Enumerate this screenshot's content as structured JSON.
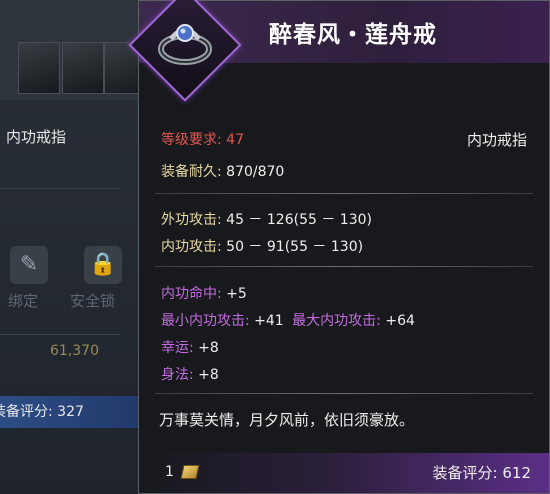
{
  "background_panel": {
    "item_type": "内功戒指",
    "bound_label": "绑定",
    "lock_label": "安全锁",
    "gold": "61,370",
    "score_label": "装备评分:",
    "score_value": "327"
  },
  "tooltip": {
    "item_name": "醉春风・莲舟戒",
    "level_req_label": "等级要求:",
    "level_req_value": "47",
    "item_type": "内功戒指",
    "durability_label": "装备耐久:",
    "durability_value": "870/870",
    "outer_attack_label": "外功攻击:",
    "outer_attack_value": "45 － 126(55 － 130)",
    "inner_attack_label": "内功攻击:",
    "inner_attack_value": "50 － 91(55 － 130)",
    "bonus_stats": [
      {
        "label": "内功命中:",
        "value": "+5"
      },
      {
        "label": "最小内功攻击:",
        "value": "+41",
        "label2": "最大内功攻击:",
        "value2": "+64"
      },
      {
        "label": "幸运:",
        "value": "+8"
      },
      {
        "label": "身法:",
        "value": "+8"
      }
    ],
    "flavor_text": "万事莫关情，月夕风前，依旧须豪放。",
    "quantity": "1",
    "score_label": "装备评分:",
    "score_value": "612"
  },
  "colors": {
    "requirement_red": "#e0574f",
    "base_stat_yellow": "#e8d8a0",
    "bonus_purple": "#c36ce0",
    "rarity_purple": "#a168d6"
  },
  "icons": [
    "ring-icon",
    "coin-icon",
    "lock-icon"
  ]
}
